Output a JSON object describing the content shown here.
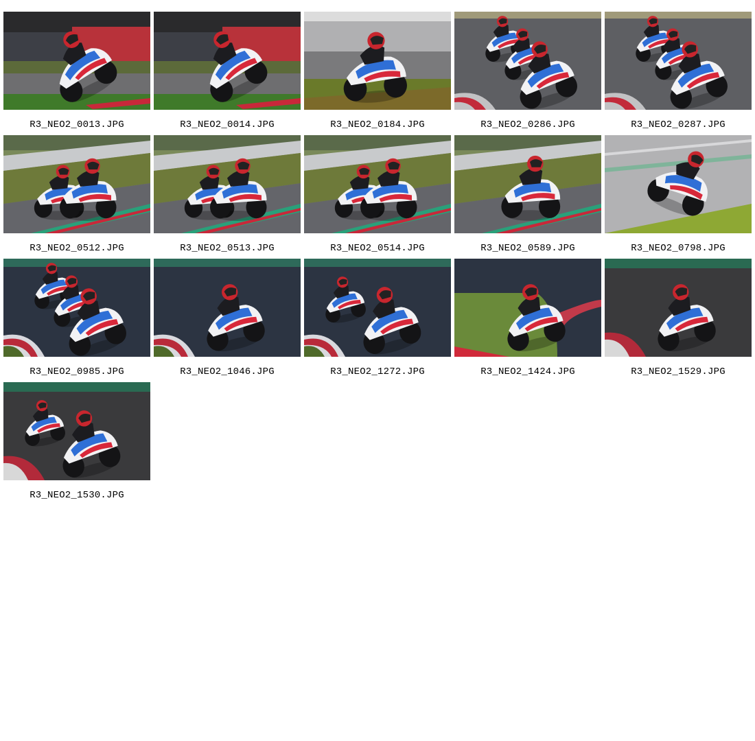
{
  "gallery": {
    "items": [
      {
        "filename": "R3_NEO2_0013.JPG",
        "scene": "banner-red",
        "rider": "single-lean-left"
      },
      {
        "filename": "R3_NEO2_0014.JPG",
        "scene": "banner-red",
        "rider": "single-lean-left"
      },
      {
        "filename": "R3_NEO2_0184.JPG",
        "scene": "grandstand",
        "rider": "single-upright"
      },
      {
        "filename": "R3_NEO2_0286.JPG",
        "scene": "asphalt-grey",
        "rider": "group-corner"
      },
      {
        "filename": "R3_NEO2_0287.JPG",
        "scene": "asphalt-grey",
        "rider": "group-corner"
      },
      {
        "filename": "R3_NEO2_0512.JPG",
        "scene": "grass-barrier",
        "rider": "pair-front"
      },
      {
        "filename": "R3_NEO2_0513.JPG",
        "scene": "grass-barrier",
        "rider": "pair-front"
      },
      {
        "filename": "R3_NEO2_0514.JPG",
        "scene": "grass-barrier",
        "rider": "pair-front"
      },
      {
        "filename": "R3_NEO2_0589.JPG",
        "scene": "grass-barrier",
        "rider": "single-front"
      },
      {
        "filename": "R3_NEO2_0798.JPG",
        "scene": "wet-grey",
        "rider": "single-lean-right"
      },
      {
        "filename": "R3_NEO2_0985.JPG",
        "scene": "dusk-blue",
        "rider": "group-corner"
      },
      {
        "filename": "R3_NEO2_1046.JPG",
        "scene": "dusk-blue",
        "rider": "single-corner"
      },
      {
        "filename": "R3_NEO2_1272.JPG",
        "scene": "dusk-blue",
        "rider": "pair-corner"
      },
      {
        "filename": "R3_NEO2_1424.JPG",
        "scene": "dusk-grass",
        "rider": "single-corner"
      },
      {
        "filename": "R3_NEO2_1529.JPG",
        "scene": "dark-asphalt",
        "rider": "single-corner"
      },
      {
        "filename": "R3_NEO2_1530.JPG",
        "scene": "dark-asphalt",
        "rider": "pair-corner"
      }
    ]
  },
  "colors": {
    "bike_white": "#f2f2f4",
    "bike_blue": "#2f6fd6",
    "bike_red": "#d8283a",
    "helmet_red": "#c8262e",
    "leathers": "#1c1c20"
  }
}
